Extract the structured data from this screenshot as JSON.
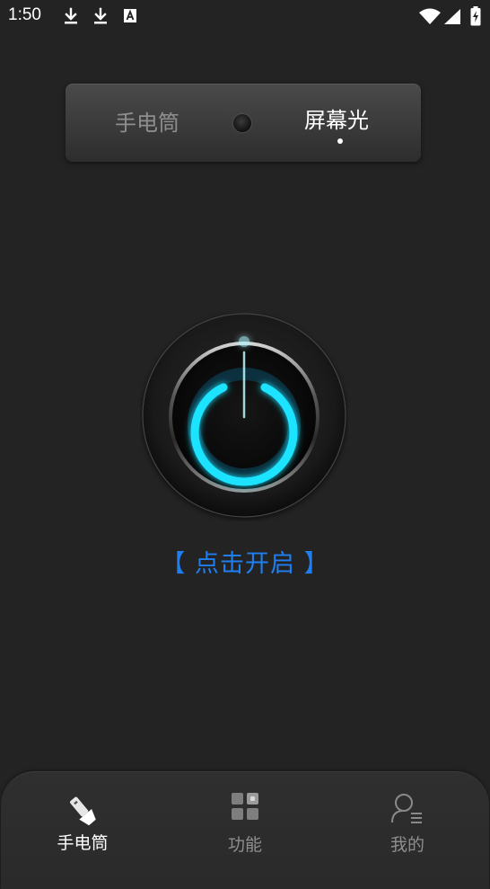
{
  "status_bar": {
    "time": "1:50",
    "icons": [
      "download-icon",
      "download-icon",
      "text-a-icon",
      "wifi-icon",
      "signal-icon",
      "battery-charging-icon"
    ]
  },
  "mode_switch": {
    "left_label": "手电筒",
    "right_label": "屏幕光",
    "selected": "屏幕光"
  },
  "power": {
    "label": "【 点击开启 】",
    "glow_color": "#1ee3ff"
  },
  "bottom_nav": {
    "items": [
      {
        "label": "手电筒",
        "icon": "flashlight-icon",
        "active": true
      },
      {
        "label": "功能",
        "icon": "grid-icon",
        "active": false
      },
      {
        "label": "我的",
        "icon": "profile-icon",
        "active": false
      }
    ]
  },
  "colors": {
    "background": "#232323",
    "accent": "#1f7ef0",
    "active_text": "#ffffff",
    "inactive_text": "#8e8e8e"
  }
}
